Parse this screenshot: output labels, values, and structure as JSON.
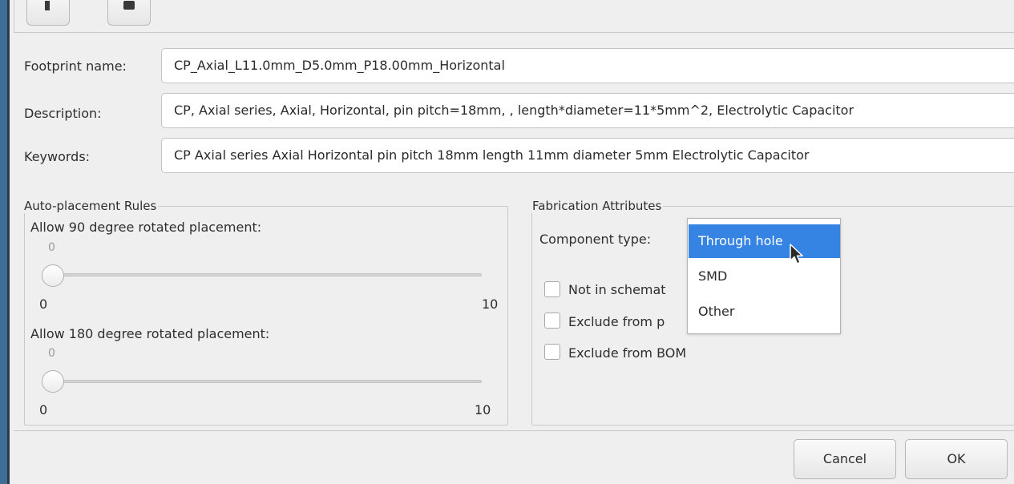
{
  "form": {
    "footprint_name_label": "Footprint name:",
    "footprint_name_value": "CP_Axial_L11.0mm_D5.0mm_P18.00mm_Horizontal",
    "description_label": "Description:",
    "description_value": "CP, Axial series, Axial, Horizontal, pin pitch=18mm, , length*diameter=11*5mm^2, Electrolytic Capacitor",
    "keywords_label": "Keywords:",
    "keywords_value": "CP Axial series Axial Horizontal pin pitch 18mm  length 11mm diameter 5mm Electrolytic Capacitor"
  },
  "auto_placement": {
    "title": "Auto-placement Rules",
    "rot90": {
      "label": "Allow 90 degree rotated placement:",
      "value": 0,
      "value_text": "0",
      "min": "0",
      "max": "10"
    },
    "rot180": {
      "label": "Allow 180 degree rotated placement:",
      "value": 0,
      "value_text": "0",
      "min": "0",
      "max": "10"
    }
  },
  "fabrication": {
    "title": "Fabrication Attributes",
    "component_type_label": "Component type:",
    "component_type_options": [
      "Through hole",
      "SMD",
      "Other"
    ],
    "component_type_highlighted": "Through hole",
    "not_in_schematic_label": "Not in schemat",
    "not_in_schematic_checked": false,
    "exclude_from_pos_label": "Exclude from p",
    "exclude_from_pos_checked": false,
    "exclude_from_bom_label": "Exclude from BOM",
    "exclude_from_bom_checked": false
  },
  "buttons": {
    "cancel": "Cancel",
    "ok": "OK"
  },
  "icons": [
    "arrow-up-icon",
    "delete-icon",
    "mouse-cursor-icon"
  ]
}
